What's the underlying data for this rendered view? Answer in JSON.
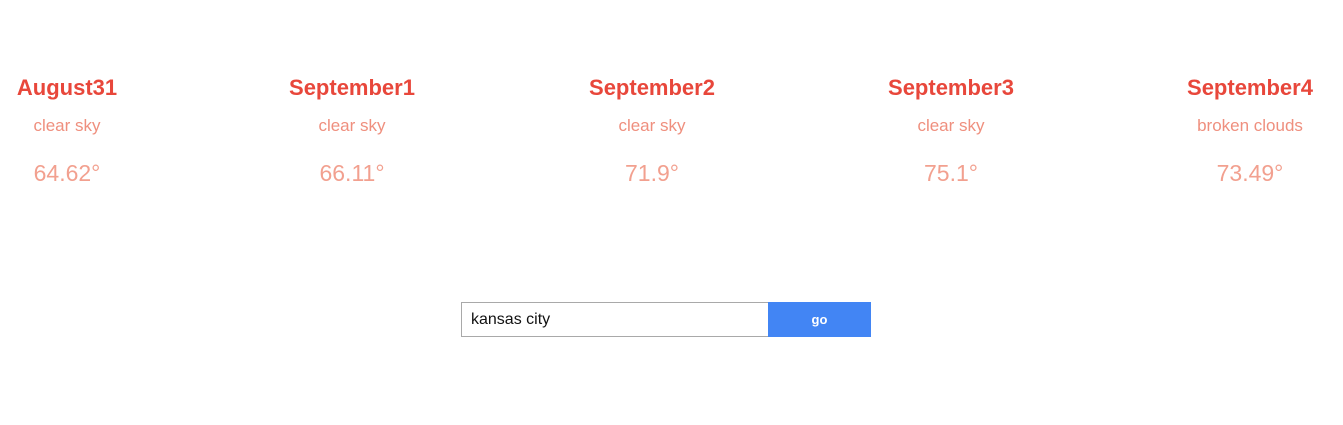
{
  "forecast": [
    {
      "date": "August31",
      "description": "clear sky",
      "temperature": "64.62°"
    },
    {
      "date": "September1",
      "description": "clear sky",
      "temperature": "66.11°"
    },
    {
      "date": "September2",
      "description": "clear sky",
      "temperature": "71.9°"
    },
    {
      "date": "September3",
      "description": "clear sky",
      "temperature": "75.1°"
    },
    {
      "date": "September4",
      "description": "broken clouds",
      "temperature": "73.49°"
    }
  ],
  "search": {
    "value": "kansas city",
    "button_label": "go"
  },
  "colors": {
    "title": "#e8473b",
    "description": "#ef8f7e",
    "temperature": "#f2a08f",
    "button": "#4285f4"
  }
}
